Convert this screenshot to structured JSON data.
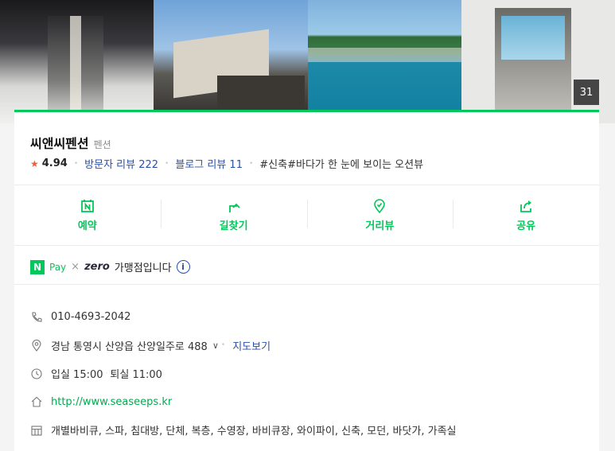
{
  "photos": {
    "count_badge": "31"
  },
  "place": {
    "name": "씨앤씨펜션",
    "category": "펜션",
    "rating": "4.94",
    "visitor_reviews": "방문자 리뷰 222",
    "blog_reviews": "블로그 리뷰 11",
    "tagline": "#신축#바다가 한 눈에 보이는 오션뷰"
  },
  "actions": [
    {
      "label": "예약",
      "icon": "calendar-n-icon"
    },
    {
      "label": "길찾기",
      "icon": "directions-icon"
    },
    {
      "label": "거리뷰",
      "icon": "map-pin-icon"
    },
    {
      "label": "공유",
      "icon": "share-icon"
    }
  ],
  "payment": {
    "npay_letter": "N",
    "pay_label": "Pay",
    "times": "×",
    "zero_label": "zero",
    "member_text": "가맹점입니다",
    "info_label": "i"
  },
  "info": {
    "phone": "010-4693-2042",
    "address": "경남 통영시 산양읍 산양일주로 488",
    "map_link": "지도보기",
    "checkin": "입실 15:00",
    "checkout": "퇴실 11:00",
    "url": "http://www.seaseeps.kr",
    "amenities": "개별바비큐, 스파, 침대방, 단체, 복층, 수영장, 바비큐장, 와이파이, 신축, 모던, 바닷가, 가족실"
  },
  "colors": {
    "accent": "#03c75a",
    "link": "#2a4fa8",
    "star": "#f55b36"
  }
}
